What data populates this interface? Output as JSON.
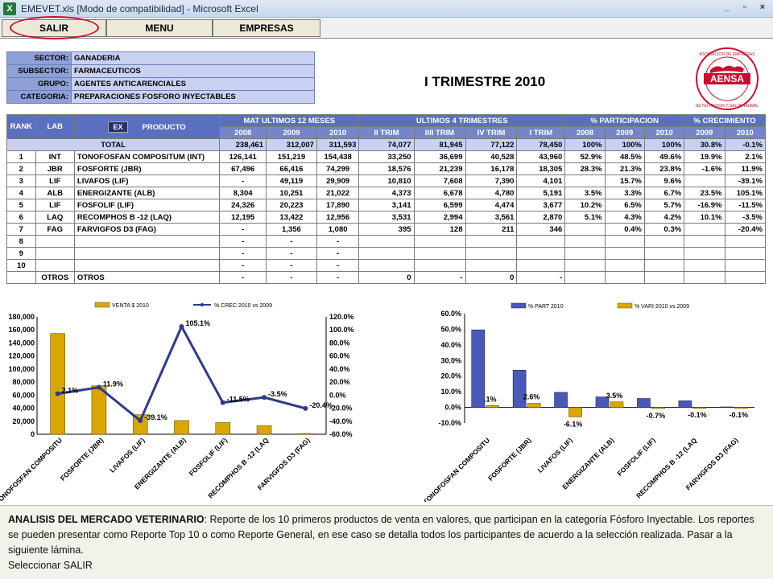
{
  "window": {
    "title": "EMEVET.xls  [Modo de compatibilidad] - Microsoft Excel",
    "app_icon": "X",
    "controls": [
      "_",
      "▫",
      "×"
    ]
  },
  "menu": {
    "salir": "SALIR",
    "menu": "MENU",
    "empresas": "EMPRESAS"
  },
  "info": [
    {
      "key": "SECTOR:",
      "value": "GANADERIA"
    },
    {
      "key": "SUBSECTOR:",
      "value": "FARMACEUTICOS"
    },
    {
      "key": "GRUPO:",
      "value": "AGENTES ANTICARENCIALES"
    },
    {
      "key": "CATEGORIA:",
      "value": "PREPARACIONES FOSFORO INYECTABLES"
    }
  ],
  "period_title": "I TRIMESTRE 2010",
  "logo": {
    "name": "AENSA",
    "ring_top": "ASOCIACION DE EMPRESAS",
    "ring_bottom": "DE NUTRICION Y SALUD ANIMAL",
    "color": "#c8102e"
  },
  "table": {
    "h_rank": "RANK",
    "h_lab": "LAB",
    "h_ex": "EX",
    "h_producto": "PRODUCTO",
    "g_mat": "MAT ULTIMOS 12 MESES",
    "g_ult": "ULTIMOS 4 TRIMESTRES",
    "g_part": "% PARTICIPACION",
    "g_crec": "% CRECIMIENTO",
    "sub": [
      "2008",
      "2009",
      "2010",
      "II TRIM",
      "IIII TRIM",
      "IV TRIM",
      "I TRIM",
      "2008",
      "2009",
      "2010",
      "2009",
      "2010"
    ],
    "total": {
      "label": "TOTAL",
      "cells": [
        "238,461",
        "312,007",
        "311,593",
        "74,077",
        "81,945",
        "77,122",
        "78,450",
        "100%",
        "100%",
        "100%",
        "30.8%",
        "-0.1%"
      ]
    },
    "rows": [
      {
        "rank": "1",
        "lab": "INT",
        "prod": "TONOFOSFAN COMPOSITUM (INT)",
        "cells": [
          "126,141",
          "151,219",
          "154,438",
          "33,250",
          "36,699",
          "40,528",
          "43,960",
          "52.9%",
          "48.5%",
          "49.6%",
          "19.9%",
          "2.1%"
        ]
      },
      {
        "rank": "2",
        "lab": "JBR",
        "prod": "FOSFORTE   (JBR)",
        "cells": [
          "67,496",
          "66,416",
          "74,299",
          "18,576",
          "21,239",
          "16,178",
          "18,305",
          "28.3%",
          "21.3%",
          "23.8%",
          "-1.6%",
          "11.9%"
        ]
      },
      {
        "rank": "3",
        "lab": "LIF",
        "prod": "LIVAFOS (LIF)",
        "cells": [
          "-",
          "49,119",
          "29,909",
          "10,810",
          "7,608",
          "7,390",
          "4,101",
          "",
          "15.7%",
          "9.6%",
          "",
          "-39.1%"
        ]
      },
      {
        "rank": "4",
        "lab": "ALB",
        "prod": "ENERGIZANTE (ALB)",
        "cells": [
          "8,304",
          "10,251",
          "21,022",
          "4,373",
          "6,678",
          "4,780",
          "5,191",
          "3.5%",
          "3.3%",
          "6.7%",
          "23.5%",
          "105.1%"
        ]
      },
      {
        "rank": "5",
        "lab": "LIF",
        "prod": "FOSFOLIF   (LIF)",
        "cells": [
          "24,326",
          "20,223",
          "17,890",
          "3,141",
          "6,599",
          "4,474",
          "3,677",
          "10.2%",
          "6.5%",
          "5.7%",
          "-16.9%",
          "-11.5%"
        ]
      },
      {
        "rank": "6",
        "lab": "LAQ",
        "prod": "RECOMPHOS B -12 (LAQ)",
        "cells": [
          "12,195",
          "13,422",
          "12,956",
          "3,531",
          "2,994",
          "3,561",
          "2,870",
          "5.1%",
          "4.3%",
          "4.2%",
          "10.1%",
          "-3.5%"
        ]
      },
      {
        "rank": "7",
        "lab": "FAG",
        "prod": "FARVIGFOS D3 (FAG)",
        "cells": [
          "-",
          "1,356",
          "1,080",
          "395",
          "128",
          "211",
          "346",
          "",
          "0.4%",
          "0.3%",
          "",
          "-20.4%"
        ]
      },
      {
        "rank": "8",
        "lab": "",
        "prod": "",
        "cells": [
          "-",
          "-",
          "-",
          "",
          "",
          "",
          "",
          "",
          "",
          "",
          "",
          ""
        ]
      },
      {
        "rank": "9",
        "lab": "",
        "prod": "",
        "cells": [
          "-",
          "-",
          "-",
          "",
          "",
          "",
          "",
          "",
          "",
          "",
          "",
          ""
        ]
      },
      {
        "rank": "10",
        "lab": "",
        "prod": "",
        "cells": [
          "-",
          "-",
          "-",
          "",
          "",
          "",
          "",
          "",
          "",
          "",
          "",
          ""
        ]
      },
      {
        "rank": "",
        "lab": "OTROS",
        "prod": "OTROS",
        "cells": [
          "-",
          "-",
          "-",
          "0",
          "-",
          "0",
          "-",
          "",
          "",
          "",
          "",
          ""
        ]
      }
    ]
  },
  "chart_data": [
    {
      "type": "bar",
      "title": "",
      "categories": [
        "TONOFOSFAN COMPOSITU",
        "FOSFORTE   (JBR)",
        "LIVAFOS (LIF)",
        "ENERGIZANTE (ALB)",
        "FOSFOLIF   (LIF)",
        "RECOMPHOS B -12 (LAQ",
        "FARVIGFOS D3 (FAG)"
      ],
      "category_labels": [
        "TONOFOSFAN COMPOSITU",
        "FOSFORTE   (JBR)",
        "LIVAFOS (LIF)",
        "ENERGIZANTE (ALB)",
        "FOSFOLIF   (LIF)",
        "RECOMPHOS B -12 (LAQ",
        "FARVIGFOS D3 (FAG)"
      ],
      "series": [
        {
          "name": "VENTA $ 2010",
          "kind": "bar",
          "axis": "left",
          "color": "#d9a800",
          "values": [
            154438,
            74299,
            29909,
            21022,
            17890,
            12956,
            1080
          ]
        },
        {
          "name": "% CREC 2010  vs  2009",
          "kind": "line",
          "axis": "right",
          "color": "#2e3a8c",
          "values": [
            2.1,
            11.9,
            -39.1,
            105.1,
            -11.5,
            -3.5,
            -20.4
          ],
          "labels": [
            "2.1%",
            "11.9%",
            "-39.1%",
            "105.1%",
            "-11.5%",
            "-3.5%",
            "-20.4%"
          ]
        }
      ],
      "ylim_left": [
        0,
        180000
      ],
      "yticks_left": [
        "0",
        "20,000",
        "40,000",
        "60,000",
        "80,000",
        "100,000",
        "120,000",
        "140,000",
        "160,000",
        "180,000"
      ],
      "ylim_right": [
        -60,
        120
      ],
      "yticks_right": [
        "-60.0%",
        "-40.0%",
        "-20.0%",
        "0.0%",
        "20.0%",
        "40.0%",
        "60.0%",
        "80.0%",
        "100.0%",
        "120.0%"
      ],
      "legend": "top"
    },
    {
      "type": "bar",
      "title": "",
      "categories": [
        "TONOFOSFAN COMPOSITU",
        "FOSFORTE   (JBR)",
        "LIVAFOS (LIF)",
        "ENERGIZANTE (ALB)",
        "FOSFOLIF   (LIF)",
        "RECOMPHOS B -12 (LAQ",
        "FARVIGFOS D3 (FAG)"
      ],
      "category_labels": [
        "TONOFOSFAN COMPOSITU",
        "FOSFORTE   (JBR)",
        "LIVAFOS (LIF)",
        "ENERGIZANTE (ALB)",
        "FOSFOLIF   (LIF)",
        "RECOMPHOS B -12 (LAQ",
        "FARVIGFOS D3 (FAG)"
      ],
      "series": [
        {
          "name": "% PART 2010",
          "color": "#4a58b8",
          "values": [
            49.6,
            23.8,
            9.6,
            6.7,
            5.7,
            4.2,
            0.3
          ]
        },
        {
          "name": "% VARI 2010  vs  2009",
          "color": "#d9a800",
          "values": [
            1.1,
            2.6,
            -6.1,
            3.5,
            -0.7,
            -0.1,
            -0.1
          ],
          "labels": [
            ".1%",
            "2.6%",
            "-6.1%",
            "3.5%",
            "-0.7%",
            "-0.1%",
            "-0.1%"
          ]
        }
      ],
      "ylim": [
        -10,
        60
      ],
      "yticks": [
        "-10.0%",
        "0.0%",
        "10.0%",
        "20.0%",
        "30.0%",
        "40.0%",
        "50.0%",
        "60.0%"
      ],
      "legend": "top"
    }
  ],
  "notes": {
    "heading": "ANALISIS DEL MERCADO VETERINARIO",
    "body": ": Reporte de los  10 primeros productos de venta en valores, que participan en la categoría Fósforo Inyectable. Los reportes se pueden presentar como Reporte Top 10 o como Reporte General, en ese caso se detalla todos  los participantes de acuerdo a la selección realizada. Pasar a la siguiente lámina.",
    "instruction": "Seleccionar SALIR"
  }
}
